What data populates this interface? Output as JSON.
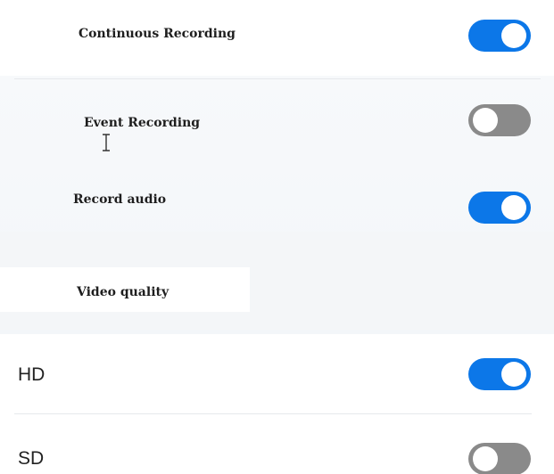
{
  "settings": {
    "items": [
      {
        "label": "Continuous Recording",
        "state": "on"
      },
      {
        "label": "Event Recording",
        "state": "off"
      },
      {
        "label": "Record audio",
        "state": "on"
      }
    ],
    "section_title": "Video quality",
    "quality_options": [
      {
        "label": "HD",
        "state": "on"
      },
      {
        "label": "SD",
        "state": "off"
      }
    ]
  },
  "colors": {
    "toggle_on": "#0c77e8",
    "toggle_off": "#8a8a8a",
    "knob": "#ffffff"
  },
  "icons": {
    "cursor": "text-cursor-icon"
  }
}
